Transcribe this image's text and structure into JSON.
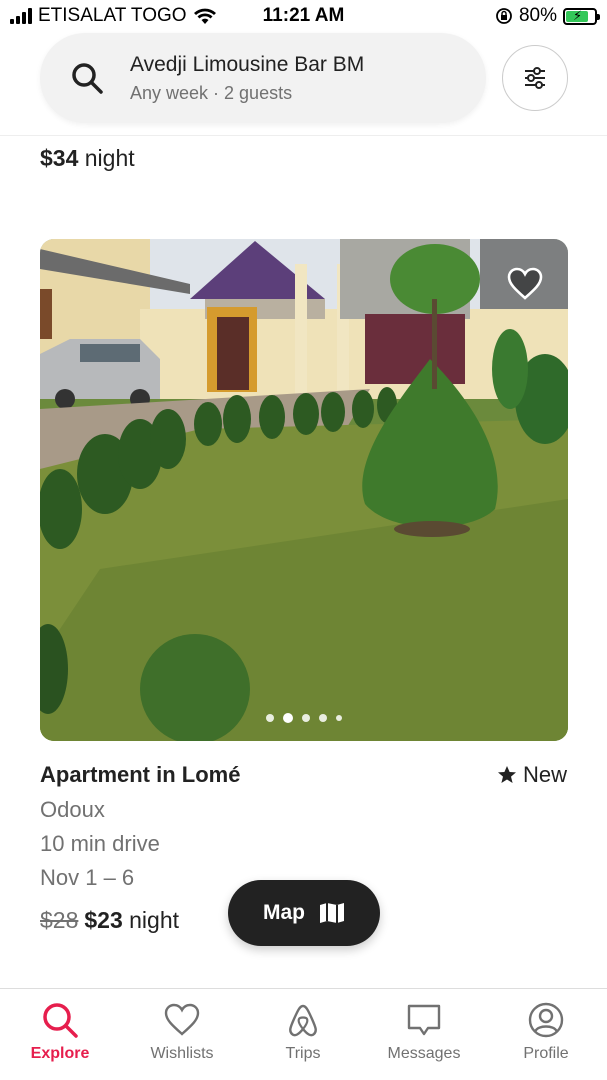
{
  "status_bar": {
    "carrier": "ETISALAT TOGO",
    "time": "11:21 AM",
    "battery": "80%"
  },
  "search": {
    "title": "Avedji Limousine Bar BM",
    "subtitle": "Any week · 2 guests",
    "icon": "search-icon"
  },
  "previous_listing": {
    "price": "$34",
    "price_unit": "night"
  },
  "listing": {
    "title": "Apartment in Lomé",
    "rating_label": "New",
    "neighborhood": "Odoux",
    "distance": "10 min drive",
    "dates": "Nov 1 – 6",
    "original_price": "$28",
    "price": "$23",
    "price_unit": "night",
    "photo_count": 5,
    "active_photo_index": 1
  },
  "map_button": {
    "label": "Map"
  },
  "bottom_nav": {
    "items": [
      {
        "label": "Explore",
        "icon": "search-icon",
        "active": true
      },
      {
        "label": "Wishlists",
        "icon": "heart-icon",
        "active": false
      },
      {
        "label": "Trips",
        "icon": "airbnb-logo-icon",
        "active": false
      },
      {
        "label": "Messages",
        "icon": "message-icon",
        "active": false
      },
      {
        "label": "Profile",
        "icon": "profile-icon",
        "active": false
      }
    ]
  },
  "colors": {
    "accent": "#e61e4d",
    "text": "#222222",
    "muted": "#717171"
  }
}
